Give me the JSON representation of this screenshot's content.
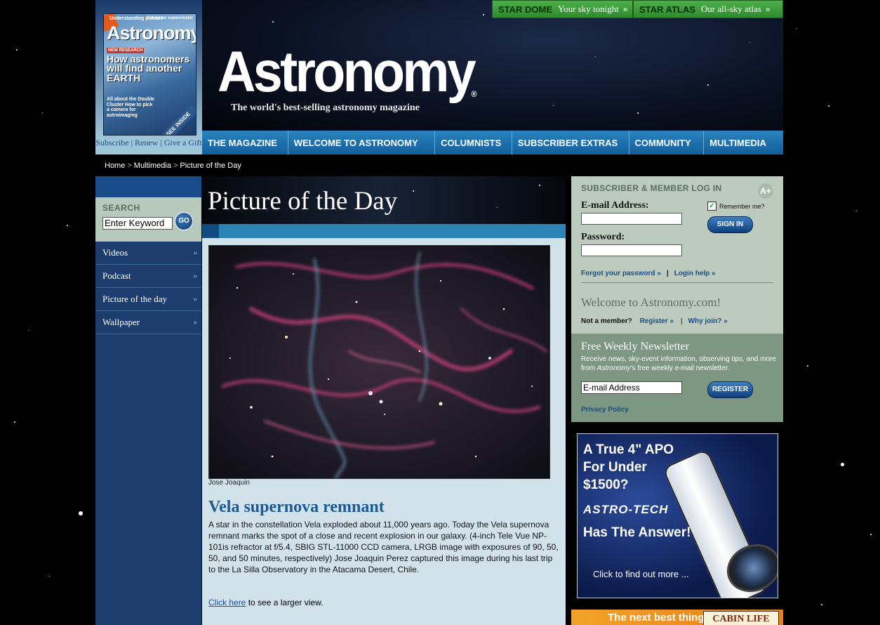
{
  "cover": {
    "title": "Astronomy",
    "top_left": "Understanding pulsars",
    "top_right": "Our home supercluster",
    "headline": "How astronomers will find another EARTH",
    "research_tag": "NEW RESEARCH",
    "lines": "All about the Double Cluster  How to pick a camera for astroimaging",
    "see_inside": "SEE INSIDE",
    "links": [
      "Subscribe",
      "Renew",
      "Give a Gift"
    ]
  },
  "top_buttons": [
    {
      "name": "STAR DOME",
      "sub": "Your sky tonight"
    },
    {
      "name": "STAR ATLAS",
      "sub": "Our all-sky atlas"
    }
  ],
  "masthead": {
    "title": "Astronomy",
    "tagline": "The world's best-selling astronomy magazine"
  },
  "nav": [
    "THE MAGAZINE",
    "WELCOME TO ASTRONOMY",
    "COLUMNISTS",
    "SUBSCRIBER EXTRAS",
    "COMMUNITY",
    "MULTIMEDIA"
  ],
  "breadcrumb": [
    "Home",
    "Multimedia",
    "Picture of the Day"
  ],
  "search": {
    "label": "SEARCH",
    "value": "Enter Keyword",
    "button": "GO"
  },
  "sidebar": [
    "Videos",
    "Podcast",
    "Picture of the day",
    "Wallpaper"
  ],
  "pod": {
    "title": "Picture of the Day",
    "credit": "Jose Joaquin",
    "heading": "Vela supernova remnant",
    "body": "A star in the constellation Vela exploded about 11,000 years ago. Today the Vela supernova remnant marks the spot of a close and recent explosion in our galaxy. (4-inch Tele Vue NP-101is refractor at f/5.4, SBIG STL-11000 CCD camera, LRGB image with exposures of 90, 50, 50, and 50 minutes, respectively) Jose Joaquin Perez captured this image during his last trip to the La Silla Observatory in the Atacama Desert, Chile.",
    "link_text": "Click here",
    "link_suffix": " to see a larger view."
  },
  "login": {
    "header": "SUBSCRIBER & MEMBER LOG IN",
    "email_label": "E-mail Address:",
    "password_label": "Password:",
    "remember": "Remember me?",
    "sign_in": "SIGN IN",
    "forgot": "Forgot your password »",
    "help": "Login help »",
    "welcome": "Welcome to Astronomy.com!",
    "not_member": "Not a member?",
    "register": "Register »",
    "why_join": "Why join? »"
  },
  "newsletter": {
    "title": "Free Weekly Newsletter",
    "text_before": "Receive news, sky-event information, observing tips, and more from ",
    "text_em": "Astronomy",
    "text_after": "'s free weekly e-mail newsletter.",
    "input_value": "E-mail Address",
    "register": "REGISTER",
    "privacy": "Privacy Policy"
  },
  "ad": {
    "headline": "A True 4\" APO For Under $1500?",
    "brand": "ASTRO-TECH",
    "tagline": "Has The Answer!",
    "cta": "Click to find out more ..."
  },
  "ad2": {
    "text": "The next best thing",
    "brand": "CABIN LIFE"
  }
}
